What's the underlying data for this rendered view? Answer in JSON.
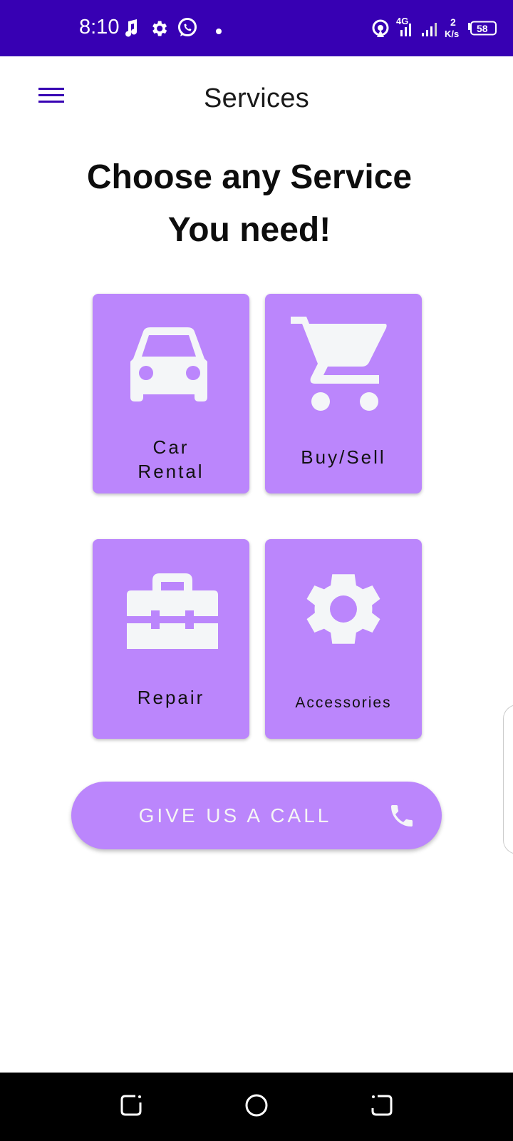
{
  "status_bar": {
    "time": "8:10",
    "network": "4G",
    "speed_value": "2",
    "speed_unit": "K/s",
    "battery": "58",
    "icons": [
      "music-notification-icon",
      "settings-notification-icon",
      "whatsapp-icon",
      "dot-icon",
      "hotspot-icon",
      "signal-icon",
      "battery-icon"
    ],
    "background": "#3700b3"
  },
  "app_bar": {
    "title": "Services",
    "menu_icon": "menu-icon"
  },
  "heading": {
    "line1": "Choose any Service",
    "line2": "You need!"
  },
  "services": [
    {
      "line1": "Car",
      "line2": "Rental",
      "icon": "car-icon"
    },
    {
      "label": "Buy/Sell",
      "icon": "cart-icon"
    },
    {
      "label": "Repair",
      "icon": "toolbox-icon"
    },
    {
      "label": "Accessories",
      "icon": "gear-icon"
    }
  ],
  "call_button": {
    "label": "GIVE US A CALL",
    "icon": "phone-icon"
  },
  "nav_bar": {
    "buttons": [
      "recents-button",
      "home-button",
      "back-button"
    ]
  },
  "colors": {
    "accent": "#bb86fc",
    "primary_dark": "#3700b3",
    "icon_fill": "#f4f6f8"
  }
}
